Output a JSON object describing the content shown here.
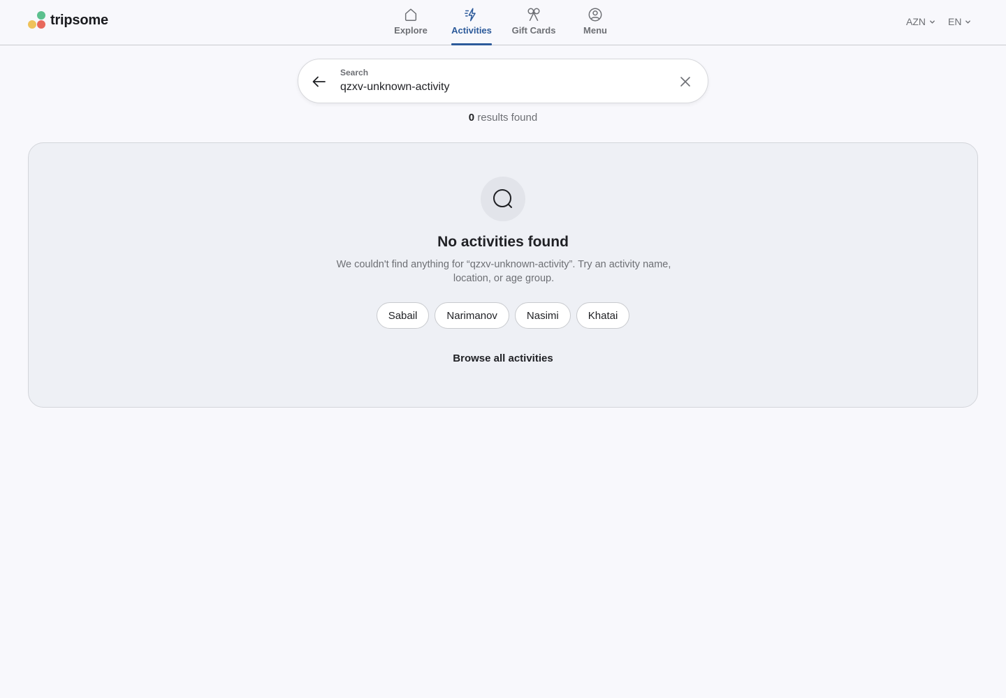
{
  "brand": {
    "name": "tripsome",
    "logo_colors": [
      "#5cc08e",
      "#efc25a",
      "#e8695c"
    ]
  },
  "nav": {
    "items": [
      {
        "label": "Explore",
        "icon": "home-icon",
        "active": false
      },
      {
        "label": "Activities",
        "icon": "lightning-icon",
        "active": true
      },
      {
        "label": "Gift Cards",
        "icon": "gift-bow-icon",
        "active": false
      },
      {
        "label": "Menu",
        "icon": "user-circle-icon",
        "active": false
      }
    ],
    "accent_color": "#2c5a9a"
  },
  "header": {
    "currency": "AZN",
    "language": "EN"
  },
  "search": {
    "label": "Search",
    "value": "qzxv-unknown-activity"
  },
  "results": {
    "count": "0",
    "suffix": "results found"
  },
  "empty_state": {
    "icon": "search-icon",
    "title": "No activities found",
    "description": "We couldn't find anything for “qzxv-unknown-activity”. Try an activity name, location, or age group.",
    "suggestions": [
      "Sabail",
      "Narimanov",
      "Nasimi",
      "Khatai"
    ],
    "browse_label": "Browse all activities"
  }
}
